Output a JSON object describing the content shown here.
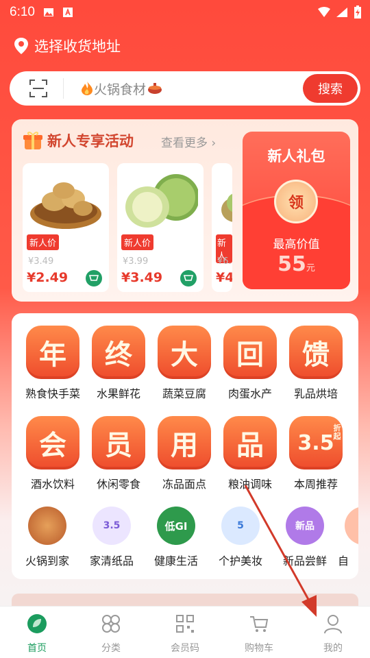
{
  "status": {
    "time": "6:10"
  },
  "address": {
    "label": "选择收货地址"
  },
  "search": {
    "placeholder": "火锅食材",
    "button": "搜索"
  },
  "new_user": {
    "title": "新人专享活动",
    "more": "查看更多",
    "products": [
      {
        "tag": "新人价",
        "old_price": "¥3.49",
        "price": "¥2.49"
      },
      {
        "tag": "新人价",
        "old_price": "¥3.99",
        "price": "¥3.49"
      },
      {
        "tag": "新人",
        "old_price": "¥6.",
        "price": "¥4"
      }
    ],
    "gift": {
      "title": "新人礼包",
      "coin": "领",
      "subtitle": "最高价值",
      "amount": "55",
      "unit": "元"
    }
  },
  "categories": [
    {
      "glyph": "年",
      "label": "熟食快手菜"
    },
    {
      "glyph": "终",
      "label": "水果鲜花"
    },
    {
      "glyph": "大",
      "label": "蔬菜豆腐"
    },
    {
      "glyph": "回",
      "label": "肉蛋水产"
    },
    {
      "glyph": "馈",
      "label": "乳品烘培"
    },
    {
      "glyph": "会",
      "label": "酒水饮料"
    },
    {
      "glyph": "员",
      "label": "休闲零食"
    },
    {
      "glyph": "用",
      "label": "冻品面点"
    },
    {
      "glyph": "品",
      "label": "粮油调味"
    },
    {
      "glyph": "3.5",
      "badge": "折起",
      "label": "本周推荐"
    }
  ],
  "shortcuts": [
    {
      "label": "火锅到家",
      "badge": ""
    },
    {
      "label": "家清纸品",
      "badge": "3.5"
    },
    {
      "label": "健康生活",
      "badge": "低GI"
    },
    {
      "label": "个护美妆",
      "badge": "5"
    },
    {
      "label": "新品尝鲜",
      "badge": "新品"
    },
    {
      "label": "自",
      "badge": ""
    }
  ],
  "tabs": [
    {
      "label": "首页",
      "icon": "home-icon"
    },
    {
      "label": "分类",
      "icon": "category-icon"
    },
    {
      "label": "会员码",
      "icon": "qr-code-icon"
    },
    {
      "label": "购物车",
      "icon": "cart-icon"
    },
    {
      "label": "我的",
      "icon": "profile-icon"
    }
  ],
  "colors": {
    "primary": "#ef3b2f",
    "green": "#1b9c5e"
  }
}
